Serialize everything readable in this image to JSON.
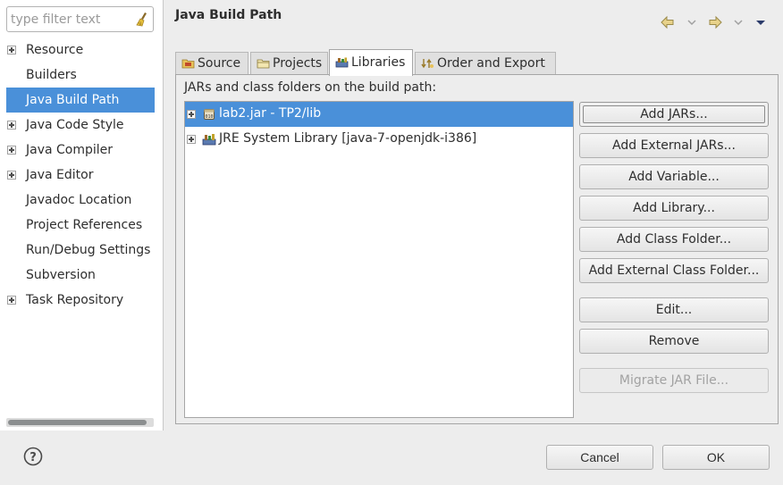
{
  "sidebar": {
    "filter_placeholder": "type filter text",
    "clear_icon": "broom-icon",
    "items": [
      {
        "label": "Resource",
        "expandable": true,
        "selected": false
      },
      {
        "label": "Builders",
        "expandable": false,
        "selected": false
      },
      {
        "label": "Java Build Path",
        "expandable": false,
        "selected": true
      },
      {
        "label": "Java Code Style",
        "expandable": true,
        "selected": false
      },
      {
        "label": "Java Compiler",
        "expandable": true,
        "selected": false
      },
      {
        "label": "Java Editor",
        "expandable": true,
        "selected": false
      },
      {
        "label": "Javadoc Location",
        "expandable": false,
        "selected": false
      },
      {
        "label": "Project References",
        "expandable": false,
        "selected": false
      },
      {
        "label": "Run/Debug Settings",
        "expandable": false,
        "selected": false
      },
      {
        "label": "Subversion",
        "expandable": false,
        "selected": false
      },
      {
        "label": "Task Repository",
        "expandable": true,
        "selected": false
      }
    ]
  },
  "page": {
    "title": "Java Build Path",
    "nav_icons": [
      "back-arrow-icon",
      "chevron-down-icon",
      "forward-arrow-icon",
      "chevron-down-icon",
      "menu-triangle-icon"
    ]
  },
  "tabs": [
    {
      "label": "Source",
      "icon": "source-folder-icon",
      "active": false
    },
    {
      "label": "Projects",
      "icon": "projects-folder-icon",
      "active": false
    },
    {
      "label": "Libraries",
      "icon": "libraries-icon",
      "active": true
    },
    {
      "label": "Order and Export",
      "icon": "order-export-icon",
      "active": false
    }
  ],
  "libraries": {
    "description": "JARs and class folders on the build path:",
    "entries": [
      {
        "label": "lab2.jar - TP2/lib",
        "icon": "jar-icon",
        "selected": true
      },
      {
        "label": "JRE System Library [java-7-openjdk-i386]",
        "icon": "library-icon",
        "selected": false
      }
    ],
    "buttons": {
      "add_jars": "Add JARs...",
      "add_external_jars": "Add External JARs...",
      "add_variable": "Add Variable...",
      "add_library": "Add Library...",
      "add_class_folder": "Add Class Folder...",
      "add_external_class_folder": "Add External Class Folder...",
      "edit": "Edit...",
      "remove": "Remove",
      "migrate_jar": "Migrate JAR File..."
    }
  },
  "footer": {
    "help_icon": "help-icon",
    "cancel": "Cancel",
    "ok": "OK"
  },
  "colors": {
    "selection": "#4a90d9",
    "window_bg": "#ededed"
  }
}
